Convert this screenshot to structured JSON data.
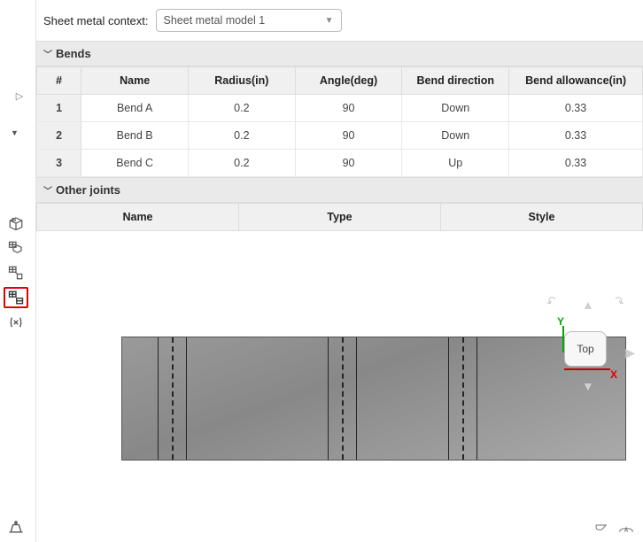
{
  "context": {
    "label": "Sheet metal context:",
    "selected": "Sheet metal model 1"
  },
  "sections": {
    "bends_title": "Bends",
    "joints_title": "Other joints"
  },
  "bends": {
    "headers": {
      "num": "#",
      "name": "Name",
      "radius": "Radius(in)",
      "angle": "Angle(deg)",
      "direction": "Bend direction",
      "allowance": "Bend allowance(in)"
    },
    "rows": [
      {
        "num": "1",
        "name": "Bend A",
        "radius": "0.2",
        "angle": "90",
        "direction": "Down",
        "allowance": "0.33"
      },
      {
        "num": "2",
        "name": "Bend B",
        "radius": "0.2",
        "angle": "90",
        "direction": "Down",
        "allowance": "0.33"
      },
      {
        "num": "3",
        "name": "Bend C",
        "radius": "0.2",
        "angle": "90",
        "direction": "Up",
        "allowance": "0.33"
      }
    ]
  },
  "joints": {
    "headers": {
      "name": "Name",
      "type": "Type",
      "style": "Style"
    },
    "rows": []
  },
  "viewcube": {
    "face": "Top",
    "axis_y": "Y",
    "axis_x": "X"
  }
}
